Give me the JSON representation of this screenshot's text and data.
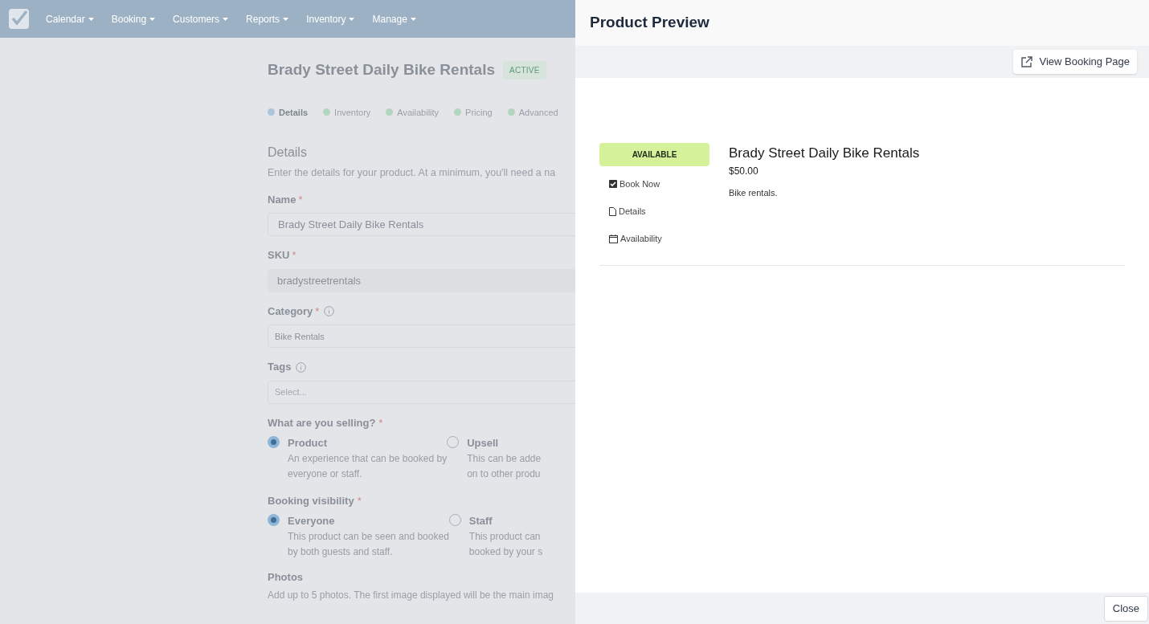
{
  "nav": {
    "items": [
      {
        "label": "Calendar"
      },
      {
        "label": "Booking"
      },
      {
        "label": "Customers"
      },
      {
        "label": "Reports"
      },
      {
        "label": "Inventory"
      },
      {
        "label": "Manage"
      }
    ]
  },
  "editor": {
    "title": "Brady Street Daily Bike Rentals",
    "status_badge": "ACTIVE",
    "steps": [
      {
        "label": "Details",
        "selected": true,
        "color": "#a9c6dc"
      },
      {
        "label": "Inventory",
        "selected": false,
        "color": "#b3d6be"
      },
      {
        "label": "Availability",
        "selected": false,
        "color": "#b3d6be"
      },
      {
        "label": "Pricing",
        "selected": false,
        "color": "#b3d6be"
      },
      {
        "label": "Advanced",
        "selected": false,
        "color": "#b3d6be"
      }
    ],
    "section_title": "Details",
    "section_hint": "Enter the details for your product. At a minimum, you'll need a na",
    "fields": [
      {
        "label": "Name",
        "required_mark": "*",
        "info": false,
        "value": "Brady Street Daily Bike Rentals",
        "kind": "text"
      },
      {
        "label": "SKU",
        "required_mark": "*",
        "info": false,
        "value": "bradystreetrentals",
        "kind": "readonly"
      },
      {
        "label": "Category",
        "required_mark": "*",
        "info": true,
        "value": "Bike Rentals",
        "kind": "select"
      },
      {
        "label": "Tags",
        "info": true,
        "placeholder": "Select...",
        "kind": "select"
      }
    ],
    "radio_groups": [
      {
        "label": "What are you selling?",
        "required_mark": "*",
        "options": [
          {
            "label": "Product",
            "description": [
              "An experience that can be booked by",
              "everyone or staff."
            ],
            "selected": true
          },
          {
            "label": "Upsell",
            "description": [
              "This can be adde",
              "on to other produ"
            ],
            "selected": false
          }
        ]
      },
      {
        "label": "Booking visibility",
        "required_mark": "*",
        "options": [
          {
            "label": "Everyone",
            "description": [
              "This product can be seen and booked",
              "by both guests and staff."
            ],
            "selected": true
          },
          {
            "label": "Staff",
            "description": [
              "This product can",
              "booked by your s"
            ],
            "selected": false
          }
        ]
      }
    ],
    "photos": {
      "label": "Photos",
      "hint": "Add up to 5 photos. The first image displayed will be the main imag"
    }
  },
  "preview": {
    "title": "Product Preview",
    "view_button": "View Booking Page",
    "availability_badge": "AVAILABLE",
    "menu": [
      {
        "label": "Book Now",
        "kind": "check"
      },
      {
        "label": "Details",
        "kind": "file"
      },
      {
        "label": "Availability",
        "kind": "calendar"
      }
    ],
    "product_name": "Brady Street Daily Bike Rentals",
    "price": "$50.00",
    "description": "Bike rentals.",
    "close_button": "Close"
  }
}
